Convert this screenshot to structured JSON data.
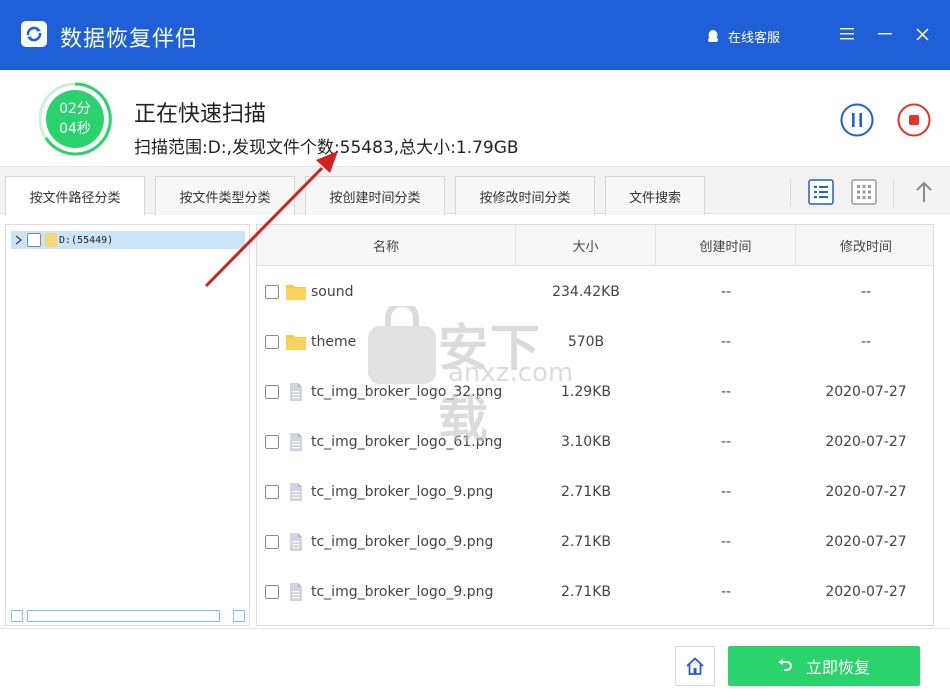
{
  "app": {
    "title": "数据恢复伴侣",
    "support_label": "在线客服"
  },
  "scan": {
    "timer_minutes": "02分",
    "timer_seconds": "04秒",
    "title": "正在快速扫描",
    "info": "扫描范围:D:,发现文件个数:55483,总大小:1.79GB"
  },
  "tabs": [
    {
      "label": "按文件路径分类",
      "active": true
    },
    {
      "label": "按文件类型分类",
      "active": false
    },
    {
      "label": "按创建时间分类",
      "active": false
    },
    {
      "label": "按修改时间分类",
      "active": false
    },
    {
      "label": "文件搜索",
      "active": false
    }
  ],
  "tree": {
    "root_label": "D:(55449)"
  },
  "table": {
    "headers": {
      "name": "名称",
      "size": "大小",
      "ctime": "创建时间",
      "mtime": "修改时间"
    },
    "rows": [
      {
        "name": "sound",
        "type": "folder",
        "size": "234.42KB",
        "ctime": "--",
        "mtime": "--"
      },
      {
        "name": "theme",
        "type": "folder",
        "size": "570B",
        "ctime": "--",
        "mtime": "--"
      },
      {
        "name": "tc_img_broker_logo_32.png",
        "type": "file",
        "size": "1.29KB",
        "ctime": "--",
        "mtime": "2020-07-27"
      },
      {
        "name": "tc_img_broker_logo_61.png",
        "type": "file",
        "size": "3.10KB",
        "ctime": "--",
        "mtime": "2020-07-27"
      },
      {
        "name": "tc_img_broker_logo_9.png",
        "type": "file",
        "size": "2.71KB",
        "ctime": "--",
        "mtime": "2020-07-27"
      },
      {
        "name": "tc_img_broker_logo_9.png",
        "type": "file",
        "size": "2.71KB",
        "ctime": "--",
        "mtime": "2020-07-27"
      },
      {
        "name": "tc_img_broker_logo_9.png",
        "type": "file",
        "size": "2.71KB",
        "ctime": "--",
        "mtime": "2020-07-27"
      }
    ]
  },
  "bottom": {
    "recover_label": "立即恢复"
  },
  "watermark": {
    "line1": "安下载",
    "line2": "anxz.com"
  },
  "colors": {
    "titlebar": "#1f5fd8",
    "accent_green": "#2bd36d",
    "pause_blue": "#1f5fd8",
    "stop_red": "#e5332a",
    "arrow_red": "#d42020"
  }
}
